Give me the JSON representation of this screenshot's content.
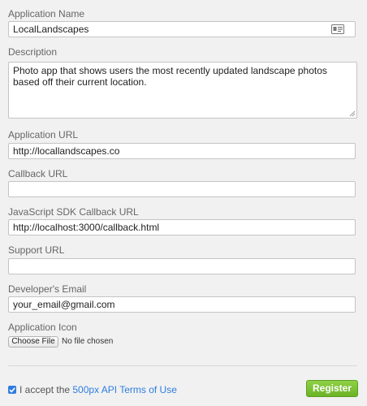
{
  "fields": {
    "app_name": {
      "label": "Application Name",
      "value": "LocalLandscapes"
    },
    "description": {
      "label": "Description",
      "value": "Photo app that shows users the most recently updated landscape photos based off their current location."
    },
    "app_url": {
      "label": "Application URL",
      "value": "http://locallandscapes.co"
    },
    "callback_url": {
      "label": "Callback URL",
      "value": ""
    },
    "js_sdk_callback_url": {
      "label": "JavaScript SDK Callback URL",
      "value": "http://localhost:3000/callback.html"
    },
    "support_url": {
      "label": "Support URL",
      "value": ""
    },
    "developer_email": {
      "label": "Developer's Email",
      "value": "your_email@gmail.com"
    },
    "app_icon": {
      "label": "Application Icon",
      "button_label": "Choose File",
      "status": "No file chosen"
    }
  },
  "terms": {
    "checked": true,
    "prefix": "I accept the ",
    "link": "500px API Terms of Use"
  },
  "register_label": "Register",
  "colors": {
    "accent_blue": "#2f7de1",
    "register_green": "#6bb327",
    "background": "#f1f1f1"
  }
}
